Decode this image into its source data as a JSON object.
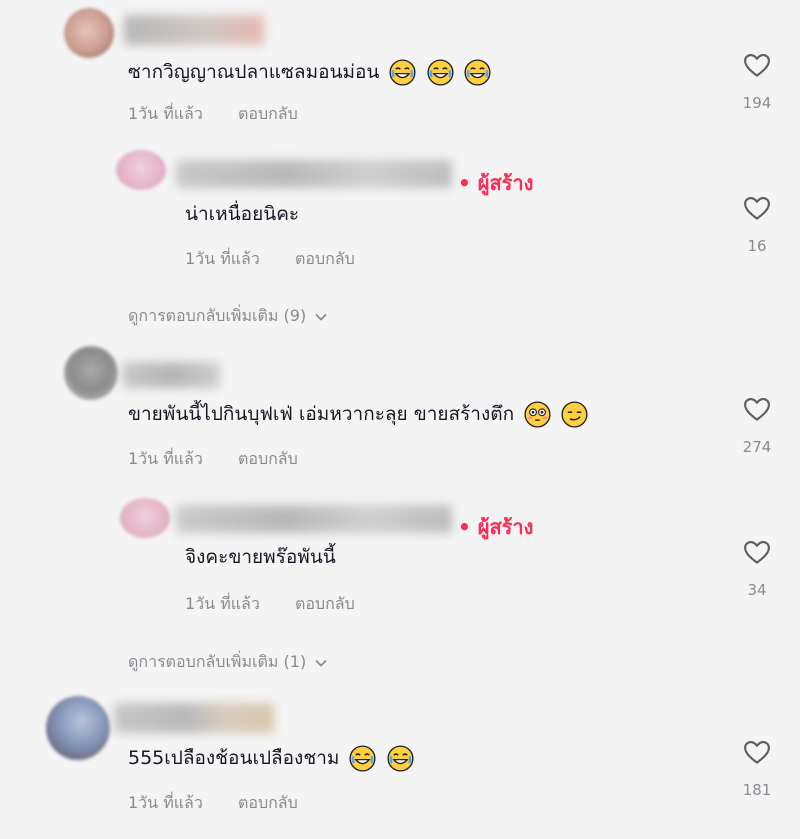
{
  "comments": [
    {
      "text": "ซากวิญญาณปลาแซลมอนม่อน",
      "emojis": [
        "laugh-cry",
        "laugh-cry",
        "laugh-cry"
      ],
      "time": "1วัน ที่แล้ว",
      "reply": "ตอบกลับ",
      "likes": "194",
      "creator_reply": {
        "badge": "• ผู้สร้าง",
        "text": "น่าเหนื่อยนิคะ",
        "time": "1วัน ที่แล้ว",
        "reply": "ตอบกลับ",
        "likes": "16"
      },
      "more_replies": "ดูการตอบกลับเพิ่มเติม (9)"
    },
    {
      "text": "ขายพันนี้ไปกินบุฟเฟ่ เอ่มหวากะลุย ขายสร้างตึก",
      "emojis": [
        "flushed",
        "smirk"
      ],
      "time": "1วัน ที่แล้ว",
      "reply": "ตอบกลับ",
      "likes": "274",
      "creator_reply": {
        "badge": "• ผู้สร้าง",
        "text": "จิงคะขายพร๊อพันนี้",
        "time": "1วัน ที่แล้ว",
        "reply": "ตอบกลับ",
        "likes": "34"
      },
      "more_replies": "ดูการตอบกลับเพิ่มเติม (1)"
    },
    {
      "text": "555เปลืองช้อนเปลืองชาม",
      "emojis": [
        "laugh-cry",
        "laugh-cry"
      ],
      "time": "1วัน ที่แล้ว",
      "reply": "ตอบกลับ",
      "likes": "181"
    }
  ],
  "icons": {
    "like": "heart-outline-icon",
    "expand": "chevron-down-icon"
  },
  "colors": {
    "creator": "#fe2c55",
    "meta": "#8a8b91",
    "text": "#161823",
    "background": "#f4f4f4"
  }
}
